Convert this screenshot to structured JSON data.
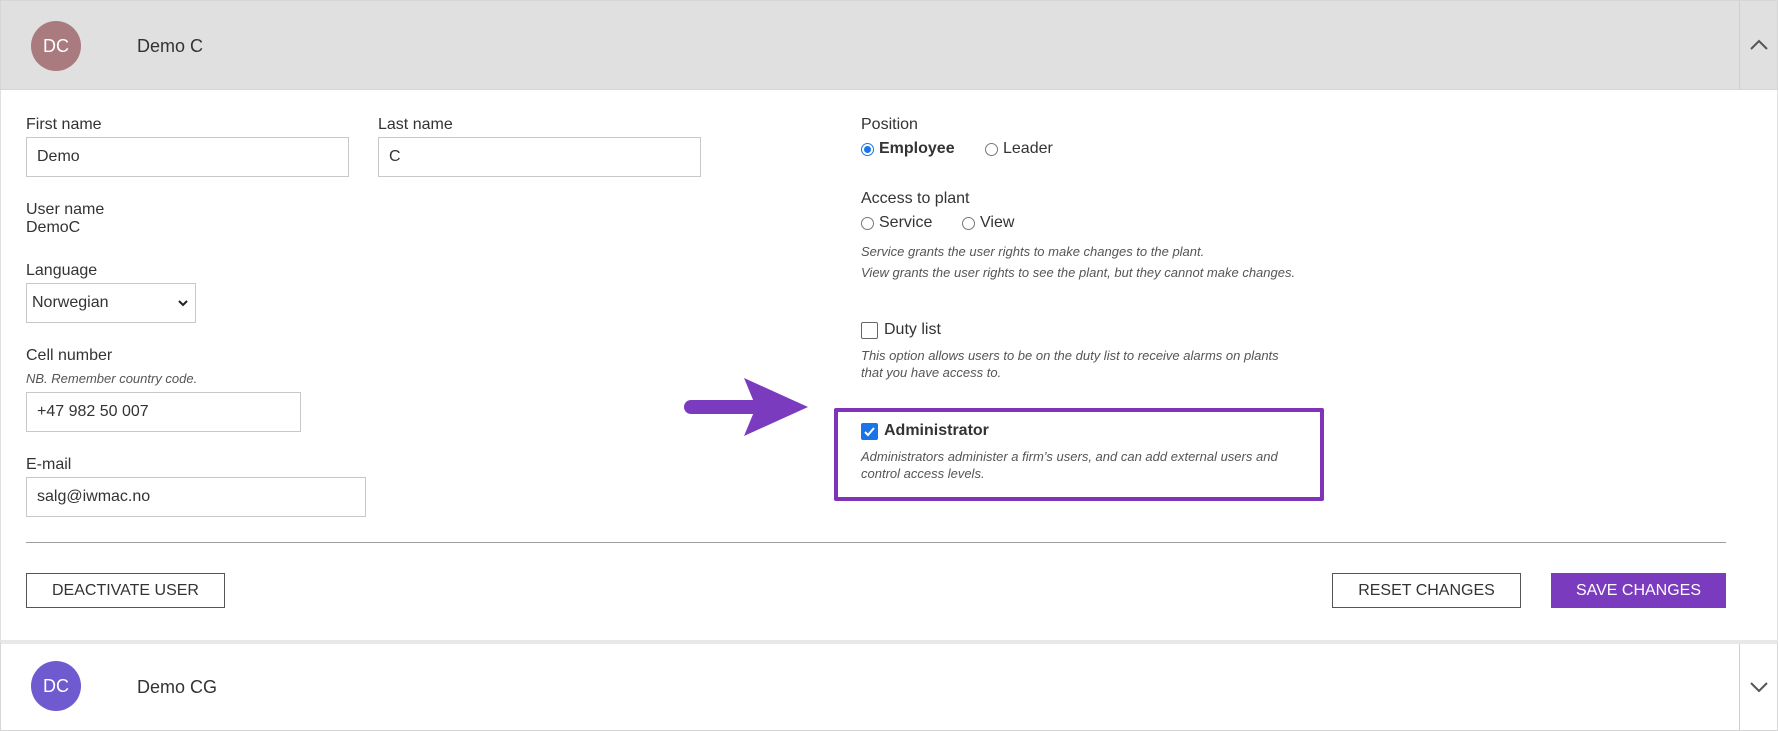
{
  "users": [
    {
      "initials": "DC",
      "name": "Demo C",
      "avatar_color": "#a97b7f",
      "expanded": true
    },
    {
      "initials": "DC",
      "name": "Demo CG",
      "avatar_color": "#6f5bcf",
      "expanded": false
    }
  ],
  "form": {
    "first_name": {
      "label": "First name",
      "value": "Demo"
    },
    "last_name": {
      "label": "Last name",
      "value": "C"
    },
    "user_name": {
      "label": "User name",
      "value": "DemoC"
    },
    "language": {
      "label": "Language",
      "selected": "Norwegian"
    },
    "cell_number": {
      "label": "Cell number",
      "hint": "NB. Remember country code.",
      "value": "+47 982 50 007"
    },
    "email": {
      "label": "E-mail",
      "value": "salg@iwmac.no"
    }
  },
  "position": {
    "label": "Position",
    "options": [
      {
        "label": "Employee",
        "selected": true
      },
      {
        "label": "Leader",
        "selected": false
      }
    ]
  },
  "access": {
    "label": "Access to plant",
    "options": [
      {
        "label": "Service",
        "selected": false
      },
      {
        "label": "View",
        "selected": false
      }
    ],
    "hint_line1": "Service grants the user rights to make changes to the plant.",
    "hint_line2": "View grants the user rights to see the plant, but they cannot make changes."
  },
  "duty_list": {
    "label": "Duty list",
    "checked": false,
    "hint_line1": "This option allows users to be on the duty list to receive alarms on plants",
    "hint_line2": "that you have access to."
  },
  "administrator": {
    "label": "Administrator",
    "checked": true,
    "hint_line1": "Administrators administer a firm’s users, and can add external users and",
    "hint_line2": "control access levels."
  },
  "buttons": {
    "deactivate": "DEACTIVATE USER",
    "reset": "RESET CHANGES",
    "save": "SAVE CHANGES"
  },
  "colors": {
    "accent": "#7b3bbf",
    "highlight": "#8032b8",
    "checkbox": "#1a73e8"
  }
}
